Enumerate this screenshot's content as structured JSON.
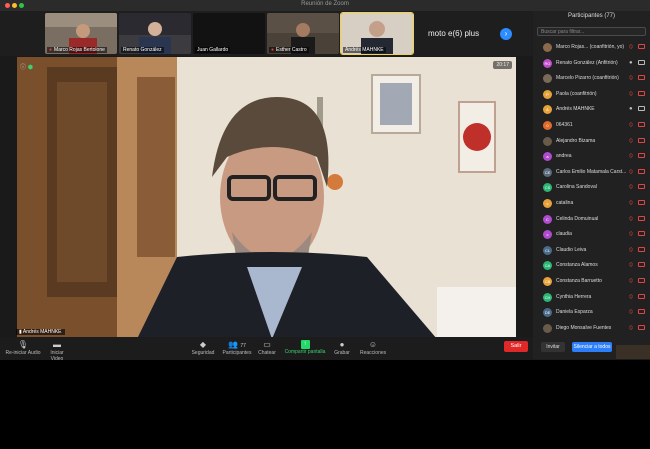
{
  "window": {
    "title": "Reunión de Zoom"
  },
  "strip": {
    "thumbnails": [
      {
        "name": "Marco Rojas Bertolone",
        "muted": true
      },
      {
        "name": "Renato González",
        "muted": false
      },
      {
        "name": "Juan Gallardo",
        "muted": false
      },
      {
        "name": "Esther Castro",
        "muted": true
      },
      {
        "name": "Andrés MAHNKE",
        "muted": true
      }
    ],
    "extra_label": "moto e(6) plus"
  },
  "video": {
    "timer": "20:17",
    "speaker": "Andrés MAHNKE"
  },
  "toolbar": {
    "reiniciar_audio": "Re-iniciar Audio",
    "iniciar_video": "Iniciar Video",
    "seguridad": "Seguridad",
    "participantes": "Participantes",
    "participantes_count": "77",
    "chatear": "Chatear",
    "compartir": "Compartir pantalla",
    "grabar": "Grabar",
    "reacciones": "Reacciones",
    "salir": "Salir"
  },
  "panel": {
    "header": "Participantes (77)",
    "search_placeholder": "Buscar para filtrar...",
    "invite": "Invitar",
    "mute_all": "Silenciar a todos",
    "participants": [
      {
        "name": "Marco Rojas... (coanfitrión, yo)",
        "initials": "",
        "color": "#8a6a4a",
        "mic_on": false,
        "cam_on": false
      },
      {
        "name": "Renato González (Anfitrión)",
        "initials": "RG",
        "color": "#c04bc9",
        "mic_on": true,
        "cam_on": true
      },
      {
        "name": "Marcelo Pizarro (coanfitrión)",
        "initials": "",
        "color": "#7a6a5a",
        "mic_on": false,
        "cam_on": false
      },
      {
        "name": "Paola (coanfitrión)",
        "initials": "P",
        "color": "#e8a23a",
        "mic_on": false,
        "cam_on": false
      },
      {
        "name": "Andrés MAHNKE",
        "initials": "A",
        "color": "#e8a23a",
        "mic_on": true,
        "cam_on": true
      },
      {
        "name": "064361",
        "initials": "0",
        "color": "#e06a2a",
        "mic_on": false,
        "cam_on": false
      },
      {
        "name": "Alejandro Bizama",
        "initials": "",
        "color": "#6a5a4a",
        "mic_on": false,
        "cam_on": false
      },
      {
        "name": "andrea",
        "initials": "a",
        "color": "#b04bd0",
        "mic_on": false,
        "cam_on": false
      },
      {
        "name": "Carlos Emilio Matamala Carst...",
        "initials": "CE",
        "color": "#5a6a7a",
        "mic_on": false,
        "cam_on": false
      },
      {
        "name": "Carolina Sandoval",
        "initials": "CS",
        "color": "#2bb673",
        "mic_on": false,
        "cam_on": false
      },
      {
        "name": "catalina",
        "initials": "c",
        "color": "#e8a23a",
        "mic_on": false,
        "cam_on": false
      },
      {
        "name": "Celinda Domuinual",
        "initials": "C",
        "color": "#b04bd0",
        "mic_on": false,
        "cam_on": false
      },
      {
        "name": "claudia",
        "initials": "c",
        "color": "#b04bd0",
        "mic_on": false,
        "cam_on": false
      },
      {
        "name": "Claudio Leiva",
        "initials": "CL",
        "color": "#4a6a8a",
        "mic_on": false,
        "cam_on": false
      },
      {
        "name": "Constanza Alamos",
        "initials": "CA",
        "color": "#2bb673",
        "mic_on": false,
        "cam_on": false
      },
      {
        "name": "Constanza Barruetto",
        "initials": "CB",
        "color": "#e8a23a",
        "mic_on": false,
        "cam_on": false
      },
      {
        "name": "Cynthia Herrera",
        "initials": "CH",
        "color": "#2bb673",
        "mic_on": false,
        "cam_on": false
      },
      {
        "name": "Daniela Esparza",
        "initials": "DE",
        "color": "#4a6a8a",
        "mic_on": false,
        "cam_on": false
      },
      {
        "name": "Diego Monsalve Fuentes",
        "initials": "",
        "color": "#6a5a4a",
        "mic_on": false,
        "cam_on": false
      }
    ]
  }
}
